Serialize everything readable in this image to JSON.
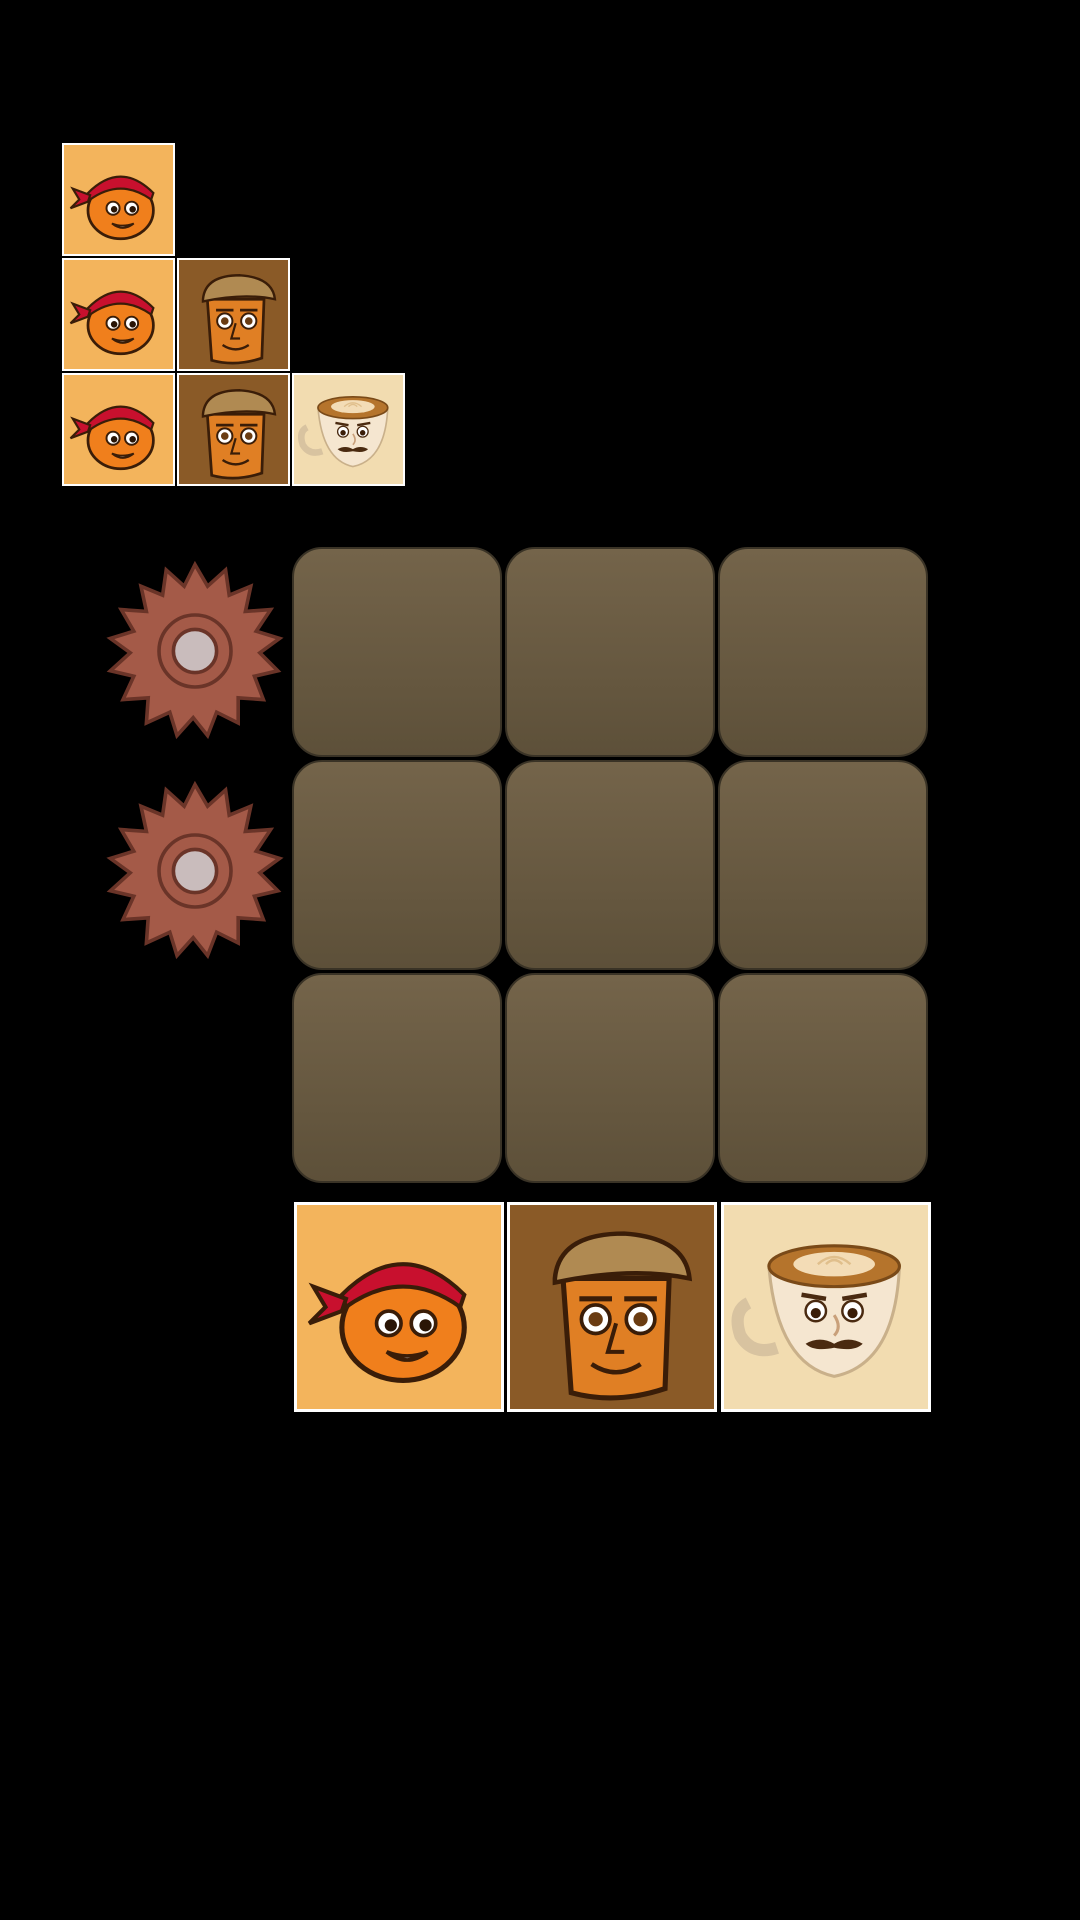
{
  "colors": {
    "background": "#000000",
    "board_cell": "#6b5b43",
    "orange_tile": "#f3b45c",
    "bread_tile": "#8a5a27",
    "coffee_tile": "#f2dcb0",
    "saw_blade": "#a45a48",
    "tile_border": "#ffffff"
  },
  "pattern_legend": {
    "rows": [
      [
        "orange-face-tile"
      ],
      [
        "orange-face-tile",
        "bread-face-tile"
      ],
      [
        "orange-face-tile",
        "bread-face-tile",
        "coffee-face-tile"
      ]
    ]
  },
  "board": {
    "rows": 3,
    "cols": 3,
    "cells": [
      [
        "empty",
        "empty",
        "empty"
      ],
      [
        "empty",
        "empty",
        "empty"
      ],
      [
        "empty",
        "empty",
        "empty"
      ]
    ]
  },
  "saws": {
    "count": 2,
    "icon": "saw-blade-icon",
    "rows": [
      1,
      2
    ]
  },
  "tray": {
    "tiles": [
      "orange-face-tile",
      "bread-face-tile",
      "coffee-face-tile"
    ]
  }
}
